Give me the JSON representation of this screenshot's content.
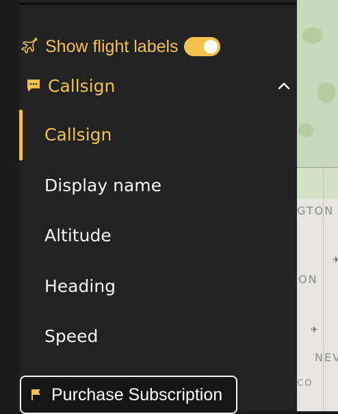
{
  "colors": {
    "accent": "#f2c14e",
    "panel_bg": "#222222",
    "text": "#f4f4f4"
  },
  "toggle": {
    "label": "Show flight labels",
    "enabled": true,
    "icon": "fighter-jet-icon"
  },
  "label_select": {
    "selected_label": "Callsign",
    "icon": "message-icon",
    "expanded": true
  },
  "options": [
    {
      "label": "Callsign",
      "selected": true
    },
    {
      "label": "Display name",
      "selected": false
    },
    {
      "label": "Altitude",
      "selected": false
    },
    {
      "label": "Heading",
      "selected": false
    },
    {
      "label": "Speed",
      "selected": false
    }
  ],
  "purchase_button": {
    "label": "Purchase Subscription",
    "icon": "flag-icon"
  },
  "map": {
    "labels": [
      "GTON",
      "ON",
      "NEV",
      "CO"
    ]
  }
}
